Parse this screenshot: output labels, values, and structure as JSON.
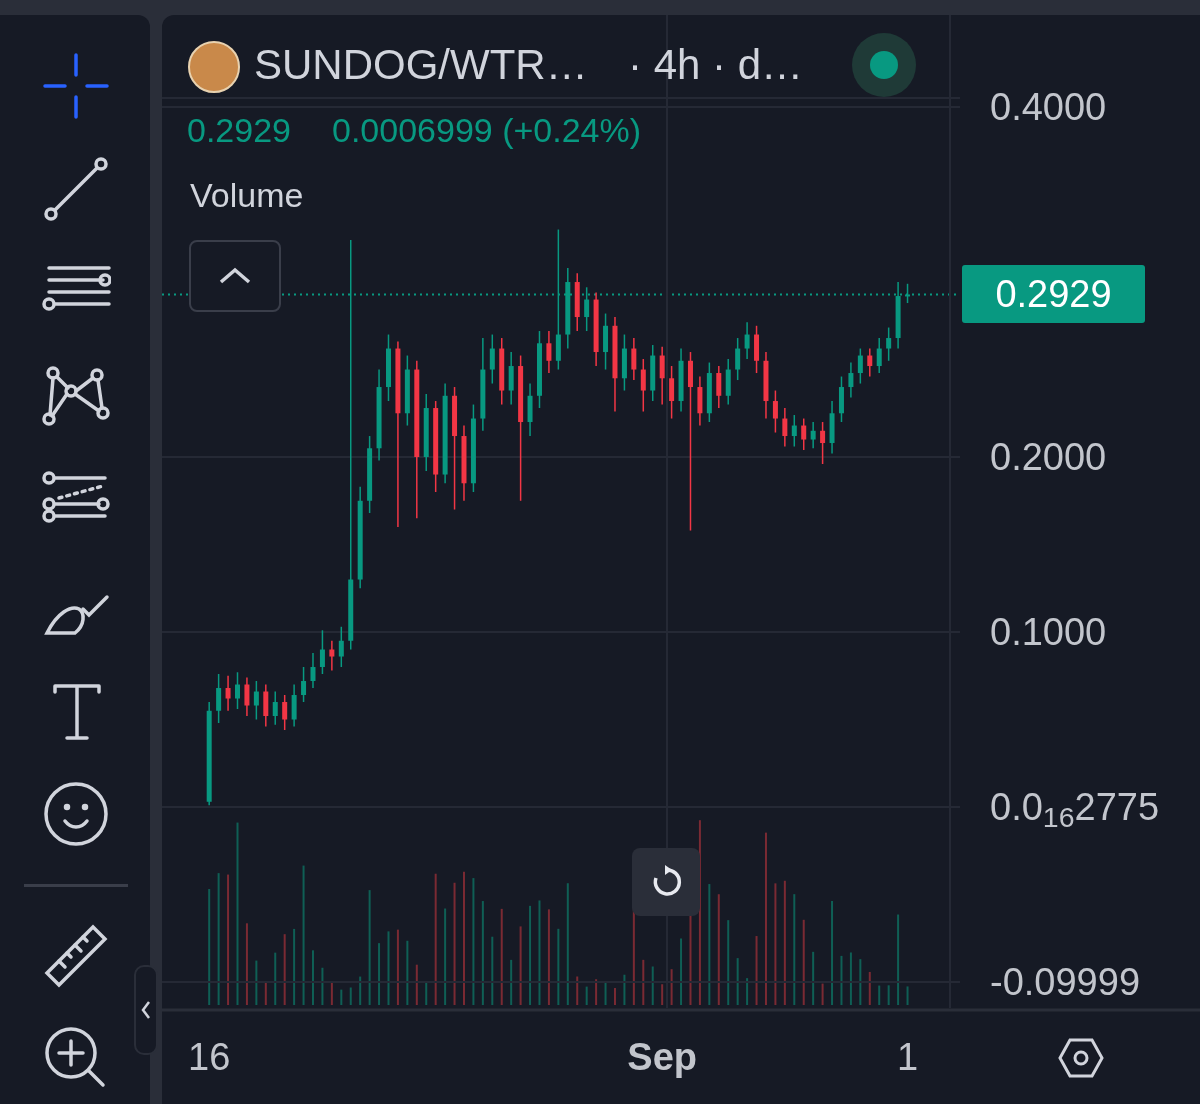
{
  "toolbar": {
    "tools": [
      {
        "kind": "crosshair",
        "selected": true
      },
      {
        "kind": "trend-line",
        "selected": false
      },
      {
        "kind": "fib",
        "selected": false
      },
      {
        "kind": "pattern",
        "selected": false
      },
      {
        "kind": "projection",
        "selected": false
      },
      {
        "kind": "brush",
        "selected": false
      },
      {
        "kind": "text",
        "selected": false
      },
      {
        "kind": "emoji",
        "selected": false
      },
      {
        "kind": "ruler",
        "selected": false
      },
      {
        "kind": "zoom",
        "selected": false
      }
    ]
  },
  "chart": {
    "symbol": "SUNDOG/WTR…",
    "interval": "· 4h · d…",
    "live": true,
    "last": "0.2929",
    "change": "0.0006999 (+0.24%)",
    "indicator": "Volume",
    "last_price_badge": "0.2929",
    "time_axis": [
      {
        "bold": false
      },
      {
        "bold": true
      },
      {
        "bold": false
      }
    ],
    "chart_data": {
      "type": "candlestick",
      "ylim": [
        -0.116,
        0.4526
      ],
      "grid": true,
      "yticks": [
        {
          "value": 0.4,
          "label": "0.4000"
        },
        {
          "value": 0.2,
          "label": "0.2000"
        },
        {
          "value": 0.1,
          "label": "0.1000"
        },
        {
          "value": 2.775e-17,
          "label": "0.0$_{16}$2775"
        },
        {
          "value": -0.09999,
          "label": "-0.09999"
        }
      ],
      "categories": [
        "16",
        null,
        null,
        null,
        null,
        null,
        null,
        null,
        null,
        null,
        null,
        null,
        null,
        null,
        null,
        null,
        null,
        null,
        null,
        null,
        null,
        null,
        null,
        null,
        null,
        null,
        null,
        null,
        null,
        null,
        null,
        null,
        null,
        null,
        null,
        null,
        null,
        null,
        null,
        null,
        null,
        null,
        null,
        null,
        null,
        null,
        null,
        null,
        "Sep",
        null,
        null,
        null,
        null,
        null,
        null,
        null,
        null,
        null,
        null,
        null,
        null,
        null,
        null,
        null,
        null,
        null,
        null,
        null,
        null,
        null,
        null,
        null,
        null,
        null,
        "1"
      ],
      "ohlc": [
        [
          0.003,
          0.06,
          0.001,
          0.055
        ],
        [
          0.055,
          0.076,
          0.048,
          0.068
        ],
        [
          0.068,
          0.075,
          0.055,
          0.062
        ],
        [
          0.062,
          0.077,
          0.056,
          0.07
        ],
        [
          0.07,
          0.074,
          0.052,
          0.058
        ],
        [
          0.058,
          0.072,
          0.05,
          0.066
        ],
        [
          0.066,
          0.07,
          0.046,
          0.052
        ],
        [
          0.052,
          0.066,
          0.047,
          0.06
        ],
        [
          0.06,
          0.064,
          0.044,
          0.05
        ],
        [
          0.05,
          0.07,
          0.046,
          0.064
        ],
        [
          0.064,
          0.08,
          0.06,
          0.072
        ],
        [
          0.072,
          0.088,
          0.068,
          0.08
        ],
        [
          0.08,
          0.101,
          0.076,
          0.09
        ],
        [
          0.09,
          0.095,
          0.078,
          0.086
        ],
        [
          0.086,
          0.103,
          0.08,
          0.095
        ],
        [
          0.095,
          0.324,
          0.09,
          0.13
        ],
        [
          0.13,
          0.183,
          0.125,
          0.175
        ],
        [
          0.175,
          0.212,
          0.168,
          0.205
        ],
        [
          0.205,
          0.25,
          0.198,
          0.24
        ],
        [
          0.24,
          0.27,
          0.232,
          0.262
        ],
        [
          0.262,
          0.266,
          0.16,
          0.225
        ],
        [
          0.225,
          0.258,
          0.218,
          0.25
        ],
        [
          0.25,
          0.255,
          0.165,
          0.2
        ],
        [
          0.2,
          0.236,
          0.192,
          0.228
        ],
        [
          0.228,
          0.232,
          0.18,
          0.19
        ],
        [
          0.19,
          0.242,
          0.185,
          0.235
        ],
        [
          0.235,
          0.24,
          0.17,
          0.212
        ],
        [
          0.212,
          0.218,
          0.175,
          0.185
        ],
        [
          0.185,
          0.23,
          0.18,
          0.222
        ],
        [
          0.222,
          0.268,
          0.215,
          0.25
        ],
        [
          0.25,
          0.27,
          0.242,
          0.262
        ],
        [
          0.262,
          0.268,
          0.23,
          0.238
        ],
        [
          0.238,
          0.26,
          0.23,
          0.252
        ],
        [
          0.252,
          0.258,
          0.175,
          0.22
        ],
        [
          0.22,
          0.242,
          0.212,
          0.235
        ],
        [
          0.235,
          0.272,
          0.228,
          0.265
        ],
        [
          0.265,
          0.272,
          0.248,
          0.255
        ],
        [
          0.255,
          0.33,
          0.25,
          0.27
        ],
        [
          0.27,
          0.308,
          0.262,
          0.3
        ],
        [
          0.3,
          0.305,
          0.272,
          0.28
        ],
        [
          0.28,
          0.297,
          0.272,
          0.29
        ],
        [
          0.29,
          0.294,
          0.252,
          0.26
        ],
        [
          0.26,
          0.282,
          0.25,
          0.275
        ],
        [
          0.275,
          0.28,
          0.226,
          0.245
        ],
        [
          0.245,
          0.27,
          0.238,
          0.262
        ],
        [
          0.262,
          0.268,
          0.244,
          0.25
        ],
        [
          0.25,
          0.256,
          0.226,
          0.238
        ],
        [
          0.238,
          0.264,
          0.232,
          0.258
        ],
        [
          0.258,
          0.263,
          0.23,
          0.245
        ],
        [
          0.245,
          0.252,
          0.222,
          0.232
        ],
        [
          0.232,
          0.262,
          0.226,
          0.255
        ],
        [
          0.255,
          0.26,
          0.158,
          0.24
        ],
        [
          0.24,
          0.246,
          0.218,
          0.225
        ],
        [
          0.225,
          0.254,
          0.22,
          0.248
        ],
        [
          0.248,
          0.252,
          0.228,
          0.235
        ],
        [
          0.235,
          0.256,
          0.23,
          0.25
        ],
        [
          0.25,
          0.268,
          0.244,
          0.262
        ],
        [
          0.262,
          0.277,
          0.256,
          0.27
        ],
        [
          0.27,
          0.275,
          0.248,
          0.255
        ],
        [
          0.255,
          0.26,
          0.222,
          0.232
        ],
        [
          0.232,
          0.238,
          0.214,
          0.222
        ],
        [
          0.222,
          0.228,
          0.206,
          0.212
        ],
        [
          0.212,
          0.224,
          0.206,
          0.218
        ],
        [
          0.218,
          0.222,
          0.204,
          0.21
        ],
        [
          0.21,
          0.22,
          0.205,
          0.215
        ],
        [
          0.215,
          0.22,
          0.196,
          0.208
        ],
        [
          0.208,
          0.232,
          0.202,
          0.225
        ],
        [
          0.225,
          0.246,
          0.22,
          0.24
        ],
        [
          0.24,
          0.254,
          0.234,
          0.248
        ],
        [
          0.248,
          0.262,
          0.242,
          0.258
        ],
        [
          0.258,
          0.262,
          0.246,
          0.252
        ],
        [
          0.252,
          0.268,
          0.248,
          0.262
        ],
        [
          0.262,
          0.274,
          0.255,
          0.268
        ],
        [
          0.268,
          0.3,
          0.262,
          0.292
        ],
        [
          0.292,
          0.299,
          0.288,
          0.2929
        ]
      ]
    }
  }
}
